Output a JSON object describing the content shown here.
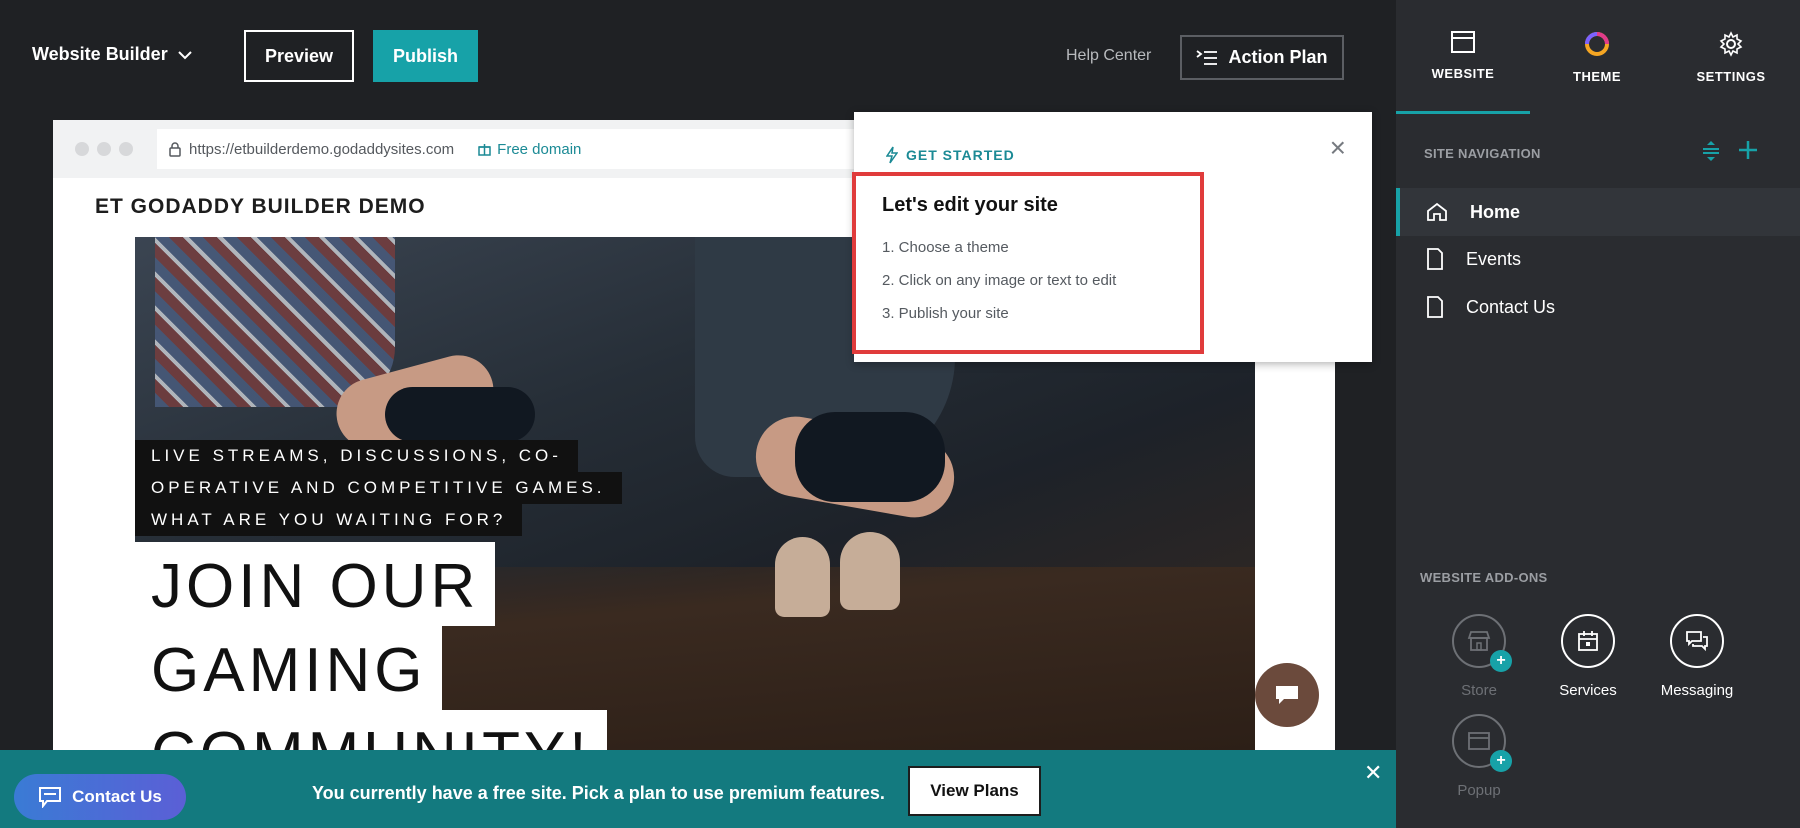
{
  "topbar": {
    "brand": "Website Builder",
    "preview_label": "Preview",
    "publish_label": "Publish",
    "help_label": "Help Center",
    "action_plan_label": "Action Plan"
  },
  "browser": {
    "url": "https://etbuilderdemo.godaddysites.com",
    "domain_label": "Free domain"
  },
  "site": {
    "title": "ET GODADDY BUILDER DEMO",
    "tagline": [
      "LIVE STREAMS, DISCUSSIONS, CO-",
      "OPERATIVE AND COMPETITIVE GAMES.",
      "WHAT ARE YOU WAITING FOR?"
    ],
    "headline": [
      "JOIN OUR",
      "GAMING",
      "COMMUNITY!"
    ]
  },
  "popover": {
    "kicker": "GET STARTED",
    "title": "Let's edit your site",
    "steps": [
      "1. Choose a theme",
      "2. Click on any image or text to edit",
      "3. Publish your site"
    ]
  },
  "promo": {
    "contact_label": "Contact Us",
    "message": "You currently have a free site. Pick a plan to use premium features.",
    "plans_label": "View Plans"
  },
  "panel": {
    "tabs": [
      {
        "label": "WEBSITE",
        "icon": "website-icon",
        "active": true
      },
      {
        "label": "THEME",
        "icon": "theme-icon",
        "active": false
      },
      {
        "label": "SETTINGS",
        "icon": "gear-icon",
        "active": false
      }
    ],
    "site_nav_label": "SITE NAVIGATION",
    "pages": [
      {
        "label": "Home",
        "icon": "home-icon",
        "active": true
      },
      {
        "label": "Events",
        "icon": "page-icon",
        "active": false
      },
      {
        "label": "Contact Us",
        "icon": "page-icon",
        "active": false
      }
    ],
    "addons_label": "WEBSITE ADD-ONS",
    "addons": [
      {
        "label": "Store",
        "icon": "store-icon",
        "enabled": false
      },
      {
        "label": "Services",
        "icon": "calendar-icon",
        "enabled": true
      },
      {
        "label": "Messaging",
        "icon": "messaging-icon",
        "enabled": true
      },
      {
        "label": "Popup",
        "icon": "popup-icon",
        "enabled": false
      }
    ]
  },
  "colors": {
    "accent": "#17a2a8",
    "promo_bg": "#137a7f",
    "highlight": "#e03b3b"
  }
}
